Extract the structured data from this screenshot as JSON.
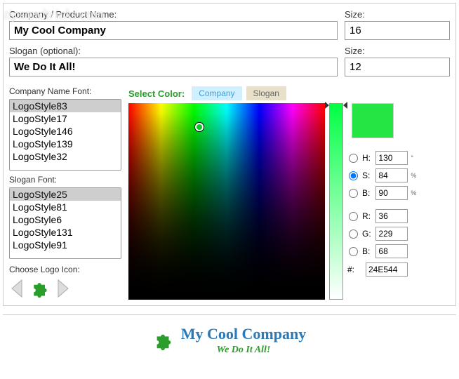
{
  "watermark": "tipsandtricks.com",
  "fields": {
    "company_label": "Company / Product Name:",
    "company_value": "My Cool Company",
    "slogan_label": "Slogan (optional):",
    "slogan_value": "We Do It All!",
    "size1_label": "Size:",
    "size1_value": "16",
    "size2_label": "Size:",
    "size2_value": "12"
  },
  "fonts": {
    "company_label": "Company Name Font:",
    "company_list": [
      "LogoStyle83",
      "LogoStyle17",
      "LogoStyle146",
      "LogoStyle139",
      "LogoStyle32"
    ],
    "company_selected": "LogoStyle83",
    "slogan_label": "Slogan Font:",
    "slogan_list": [
      "LogoStyle25",
      "LogoStyle81",
      "LogoStyle6",
      "LogoStyle131",
      "LogoStyle91"
    ],
    "slogan_selected": "LogoStyle25",
    "choose_icon_label": "Choose Logo Icon:"
  },
  "color": {
    "select_label": "Select Color:",
    "tab_company": "Company",
    "tab_slogan": "Slogan",
    "active_tab": "Company",
    "swatch": "#24E544",
    "H_label": "H:",
    "H": "130",
    "H_unit": "°",
    "S_label": "S:",
    "S": "84",
    "S_unit": "%",
    "B_label": "B:",
    "B": "90",
    "B_unit": "%",
    "R_label": "R:",
    "R": "36",
    "G_label": "G:",
    "G": "229",
    "Bb_label": "B:",
    "Bb": "68",
    "hex_label": "#:",
    "hex": "24E544",
    "selected_radio": "S"
  },
  "preview": {
    "company": "My Cool Company",
    "slogan": "We Do It All!"
  }
}
